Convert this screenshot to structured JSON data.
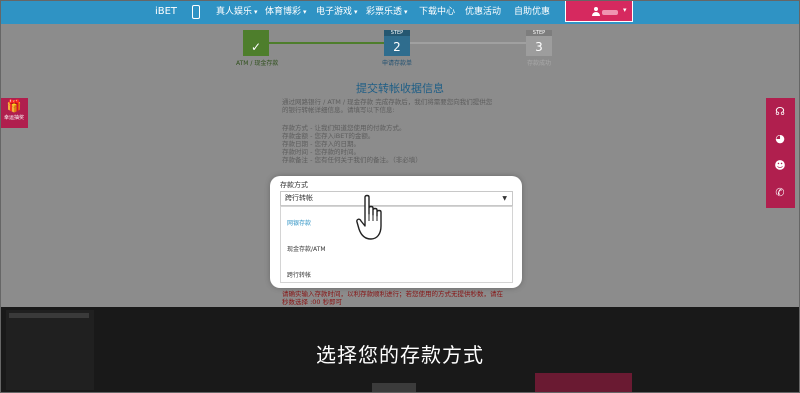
{
  "nav": {
    "brand": "iBET",
    "items": [
      {
        "label": "真人娱乐",
        "has_caret": true
      },
      {
        "label": "体育博彩",
        "has_caret": true
      },
      {
        "label": "电子游戏",
        "has_caret": true
      },
      {
        "label": "彩票乐透",
        "has_caret": true
      },
      {
        "label": "下载中心",
        "has_caret": false
      },
      {
        "label": "优惠活动",
        "has_caret": false
      },
      {
        "label": "自助优惠",
        "has_caret": false
      }
    ],
    "caret": "▾",
    "user_caret": "▾"
  },
  "steps": [
    {
      "tag": "",
      "symbol": "✓",
      "label": "ATM / 现金存款"
    },
    {
      "tag": "STEP",
      "symbol": "2",
      "label": "申请存款单"
    },
    {
      "tag": "STEP",
      "symbol": "3",
      "label": "存款成功"
    }
  ],
  "heading": "提交转帐收据信息",
  "intro_lines": [
    "通过网路银行 / ATM / 现金存款 完成存款后，我们将需要您向我们提供您",
    "的银行转帐详细信息。请填写以下信息:"
  ],
  "info_lines": [
    "存款方式 - 让我们知道您使用的付款方式。",
    "存款金额 - 您存入iBET的金额。",
    "存款日期 - 您存入的日期。",
    "存款时间 - 您存款的时间。",
    "存款备注 - 您有任何关于我们的备注。（非必填）"
  ],
  "warning_lines": [
    "请确实输入存款时间，以利存款顺利进行；若您使用的方式无提供秒数，请在",
    "秒数选择 :00 秒即可"
  ],
  "side_left": {
    "icon": "gift-icon",
    "label": "幸运抽奖"
  },
  "side_right_icons": [
    "headset-icon",
    "wechat-icon",
    "qq-icon",
    "phone-icon"
  ],
  "form": {
    "label": "存款方式",
    "selected": "跨行转帐",
    "options": [
      "网银存款",
      "现金存款/ATM",
      "跨行转帐"
    ],
    "active_option": "网银存款"
  },
  "caption": "选择您的存款方式"
}
